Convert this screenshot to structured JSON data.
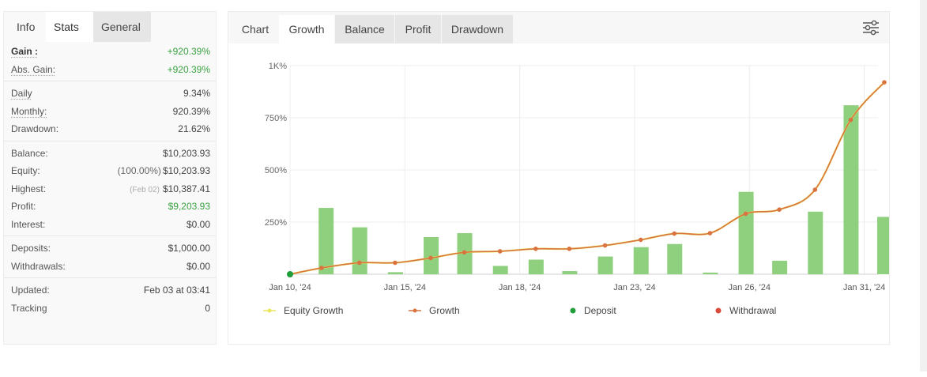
{
  "left_tabs": [
    {
      "label": "Info"
    },
    {
      "label": "Stats"
    },
    {
      "label": "General"
    }
  ],
  "stats": {
    "gain": {
      "label": "Gain :",
      "value": "+920.39%"
    },
    "abs_gain": {
      "label": "Abs. Gain:",
      "value": "+920.39%"
    },
    "daily": {
      "label": "Daily",
      "value": "9.34%"
    },
    "monthly": {
      "label": "Monthly:",
      "value": "920.39%"
    },
    "drawdown": {
      "label": "Drawdown:",
      "value": "21.62%"
    },
    "balance": {
      "label": "Balance:",
      "value": "$10,203.93"
    },
    "equity": {
      "label": "Equity:",
      "sub": "(100.00%)",
      "value": "$10,203.93"
    },
    "highest": {
      "label": "Highest:",
      "sub": "(Feb 02)",
      "value": "$10,387.41"
    },
    "profit": {
      "label": "Profit:",
      "value": "$9,203.93"
    },
    "interest": {
      "label": "Interest:",
      "value": "$0.00"
    },
    "deposits": {
      "label": "Deposits:",
      "value": "$1,000.00"
    },
    "withdrawals": {
      "label": "Withdrawals:",
      "value": "$0.00"
    },
    "updated": {
      "label": "Updated:",
      "value": "Feb 03 at 03:41"
    },
    "tracking": {
      "label": "Tracking",
      "value": "0"
    }
  },
  "chart_tabs": [
    {
      "label": "Chart"
    },
    {
      "label": "Growth"
    },
    {
      "label": "Balance"
    },
    {
      "label": "Profit"
    },
    {
      "label": "Drawdown"
    }
  ],
  "settings_icon": "sliders-icon",
  "colors": {
    "positive": "#3aa142",
    "bar": "#8fd07f",
    "growth_line": "#d9733f",
    "equity_line": "#e8e85a",
    "deposit": "#1f9e3a",
    "withdrawal": "#d94a3a"
  },
  "chart_data": {
    "type": "line",
    "y_tick_labels": [
      "1K%",
      "750%",
      "500%",
      "250%"
    ],
    "y_ticks": [
      1000,
      750,
      500,
      250
    ],
    "ylim": [
      0,
      1000
    ],
    "x_tick_labels": [
      "Jan 10, '24",
      "Jan 15, '24",
      "Jan 18, '24",
      "Jan 23, '24",
      "Jan 26, '24",
      "Jan 31, '24"
    ],
    "x_tick_index": [
      0,
      5,
      10,
      15,
      20,
      25
    ],
    "grid": true,
    "legend_position": "bottom",
    "days": 28,
    "series": [
      {
        "name": "Equity Growth",
        "kind": "line",
        "values": [
          0,
          30,
          55,
          55,
          78,
          105,
          110,
          122,
          122,
          138,
          165,
          195,
          197,
          200,
          205,
          225,
          230,
          200,
          290,
          310,
          400,
          740,
          920
        ]
      },
      {
        "name": "Growth",
        "kind": "line",
        "values": [
          0,
          30,
          55,
          55,
          78,
          105,
          110,
          122,
          122,
          138,
          165,
          195,
          197,
          290,
          310,
          405,
          740,
          920
        ]
      }
    ],
    "growth_points": [
      {
        "day": 0,
        "value": 0
      },
      {
        "day": 1.5,
        "value": 30
      },
      {
        "day": 3.3,
        "value": 55
      },
      {
        "day": 5,
        "value": 55
      },
      {
        "day": 6.7,
        "value": 78
      },
      {
        "day": 8.3,
        "value": 105
      },
      {
        "day": 10,
        "value": 110
      },
      {
        "day": 11.7,
        "value": 122
      },
      {
        "day": 13.3,
        "value": 122
      },
      {
        "day": 15,
        "value": 138
      },
      {
        "day": 16.7,
        "value": 165
      },
      {
        "day": 18.3,
        "value": 195
      },
      {
        "day": 20,
        "value": 197
      },
      {
        "day": 21.7,
        "value": 290
      },
      {
        "day": 23.3,
        "value": 310
      },
      {
        "day": 25,
        "value": 405
      },
      {
        "day": 26.7,
        "value": 740
      },
      {
        "day": 28.3,
        "value": 920
      }
    ],
    "daily_bars": [
      {
        "day": 1.7,
        "value": 318
      },
      {
        "day": 3.3,
        "value": 225
      },
      {
        "day": 5,
        "value": 10
      },
      {
        "day": 6.7,
        "value": 178
      },
      {
        "day": 8.3,
        "value": 197
      },
      {
        "day": 10,
        "value": 40
      },
      {
        "day": 11.7,
        "value": 70
      },
      {
        "day": 13.3,
        "value": 15
      },
      {
        "day": 15,
        "value": 85
      },
      {
        "day": 16.7,
        "value": 130
      },
      {
        "day": 18.3,
        "value": 145
      },
      {
        "day": 20,
        "value": 8
      },
      {
        "day": 21.7,
        "value": 395
      },
      {
        "day": 23.3,
        "value": 65
      },
      {
        "day": 25,
        "value": 300
      },
      {
        "day": 26.7,
        "value": 810
      },
      {
        "day": 28.3,
        "value": 275
      }
    ],
    "deposit_points": [
      {
        "day": 0,
        "value": 0
      }
    ],
    "withdrawal_points": [],
    "legend": [
      {
        "label": "Equity Growth",
        "marker": "line"
      },
      {
        "label": "Growth",
        "marker": "line"
      },
      {
        "label": "Deposit",
        "marker": "dot"
      },
      {
        "label": "Withdrawal",
        "marker": "dot"
      }
    ]
  }
}
